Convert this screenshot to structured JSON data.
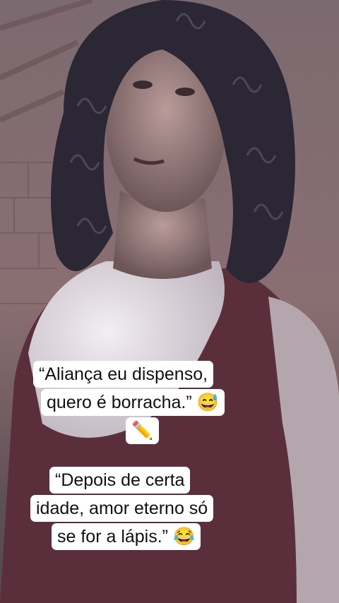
{
  "captions": {
    "first": {
      "line1": "“Aliança eu dispenso,",
      "line2": "quero é borracha.” 😅",
      "line3": "✏️"
    },
    "second": {
      "line1": "“Depois de certa",
      "line2": "idade, amor eterno só",
      "line3": "se for a lápis.” 😂"
    }
  }
}
